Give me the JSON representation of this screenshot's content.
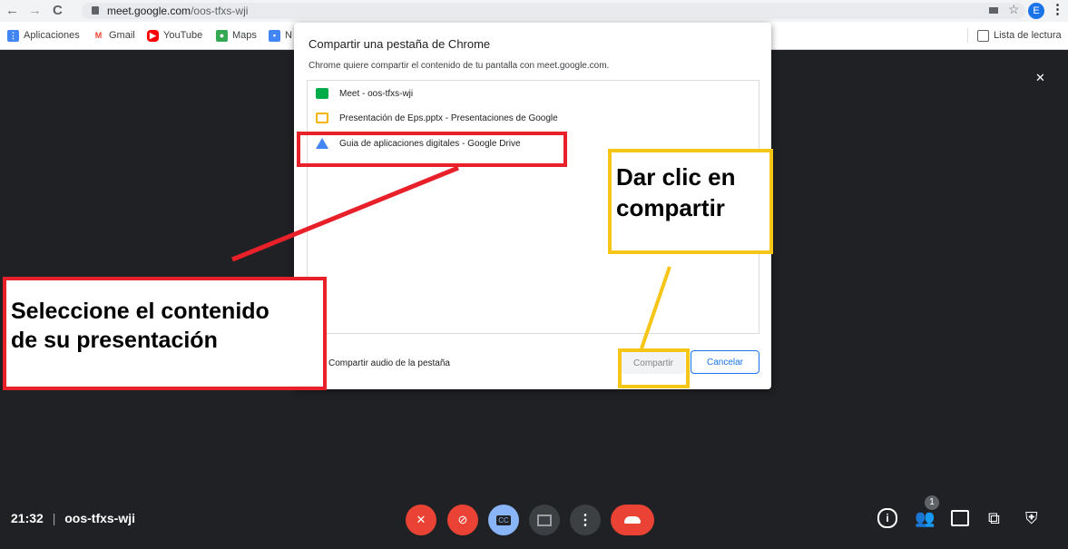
{
  "browser": {
    "url_host": "meet.google.com",
    "url_path": "/oos-tfxs-wji",
    "profile_initial": "E",
    "bookmarks": [
      {
        "label": "Aplicaciones",
        "color": "#4285f4"
      },
      {
        "label": "Gmail",
        "color": "#ea4335"
      },
      {
        "label": "YouTube",
        "color": "#ff0000"
      },
      {
        "label": "Maps",
        "color": "#34a853"
      },
      {
        "label": "N",
        "color": "#4285f4"
      }
    ],
    "reading_list": "Lista de lectura"
  },
  "dialog": {
    "title": "Compartir una pestaña de Chrome",
    "subtitle": "Chrome quiere compartir el contenido de tu pantalla con meet.google.com.",
    "tabs": [
      {
        "label": "Meet - oos-tfxs-wji",
        "icon": "meet-icon",
        "color": "#00ac47"
      },
      {
        "label": "Presentación de Eps.pptx - Presentaciones de Google",
        "icon": "slides-icon",
        "color": "#f4b400"
      },
      {
        "label": "Guia de aplicaciones digitales - Google Drive",
        "icon": "drive-icon",
        "color": "#4285f4"
      }
    ],
    "audio_label": "Compartir audio de la pestaña",
    "share_label": "Compartir",
    "cancel_label": "Cancelar"
  },
  "annotations": {
    "select_text_line1": "Seleccione el contenido",
    "select_text_line2": "de su presentación",
    "click_text_line1": "Dar clic en",
    "click_text_line2": "compartir"
  },
  "meet": {
    "time": "21:32",
    "separator": "|",
    "code": "oos-tfxs-wji",
    "participants_badge": "1",
    "colors": {
      "red": "#ea4335",
      "gray": "#3c4043",
      "blue": "#8ab4f8"
    }
  }
}
